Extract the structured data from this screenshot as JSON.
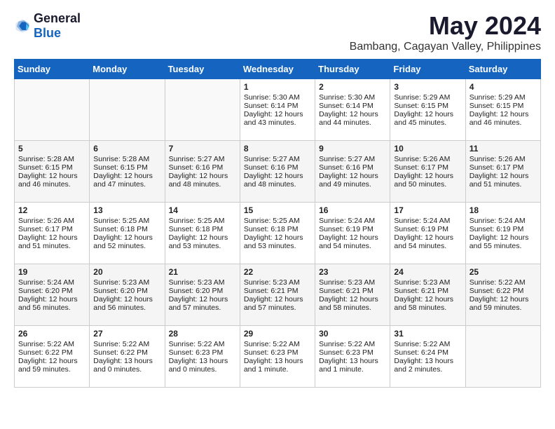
{
  "logo": {
    "general": "General",
    "blue": "Blue"
  },
  "header": {
    "month_year": "May 2024",
    "location": "Bambang, Cagayan Valley, Philippines"
  },
  "days_of_week": [
    "Sunday",
    "Monday",
    "Tuesday",
    "Wednesday",
    "Thursday",
    "Friday",
    "Saturday"
  ],
  "weeks": [
    [
      {
        "day": "",
        "content": ""
      },
      {
        "day": "",
        "content": ""
      },
      {
        "day": "",
        "content": ""
      },
      {
        "day": "1",
        "content": "Sunrise: 5:30 AM\nSunset: 6:14 PM\nDaylight: 12 hours\nand 43 minutes."
      },
      {
        "day": "2",
        "content": "Sunrise: 5:30 AM\nSunset: 6:14 PM\nDaylight: 12 hours\nand 44 minutes."
      },
      {
        "day": "3",
        "content": "Sunrise: 5:29 AM\nSunset: 6:15 PM\nDaylight: 12 hours\nand 45 minutes."
      },
      {
        "day": "4",
        "content": "Sunrise: 5:29 AM\nSunset: 6:15 PM\nDaylight: 12 hours\nand 46 minutes."
      }
    ],
    [
      {
        "day": "5",
        "content": "Sunrise: 5:28 AM\nSunset: 6:15 PM\nDaylight: 12 hours\nand 46 minutes."
      },
      {
        "day": "6",
        "content": "Sunrise: 5:28 AM\nSunset: 6:15 PM\nDaylight: 12 hours\nand 47 minutes."
      },
      {
        "day": "7",
        "content": "Sunrise: 5:27 AM\nSunset: 6:16 PM\nDaylight: 12 hours\nand 48 minutes."
      },
      {
        "day": "8",
        "content": "Sunrise: 5:27 AM\nSunset: 6:16 PM\nDaylight: 12 hours\nand 48 minutes."
      },
      {
        "day": "9",
        "content": "Sunrise: 5:27 AM\nSunset: 6:16 PM\nDaylight: 12 hours\nand 49 minutes."
      },
      {
        "day": "10",
        "content": "Sunrise: 5:26 AM\nSunset: 6:17 PM\nDaylight: 12 hours\nand 50 minutes."
      },
      {
        "day": "11",
        "content": "Sunrise: 5:26 AM\nSunset: 6:17 PM\nDaylight: 12 hours\nand 51 minutes."
      }
    ],
    [
      {
        "day": "12",
        "content": "Sunrise: 5:26 AM\nSunset: 6:17 PM\nDaylight: 12 hours\nand 51 minutes."
      },
      {
        "day": "13",
        "content": "Sunrise: 5:25 AM\nSunset: 6:18 PM\nDaylight: 12 hours\nand 52 minutes."
      },
      {
        "day": "14",
        "content": "Sunrise: 5:25 AM\nSunset: 6:18 PM\nDaylight: 12 hours\nand 53 minutes."
      },
      {
        "day": "15",
        "content": "Sunrise: 5:25 AM\nSunset: 6:18 PM\nDaylight: 12 hours\nand 53 minutes."
      },
      {
        "day": "16",
        "content": "Sunrise: 5:24 AM\nSunset: 6:19 PM\nDaylight: 12 hours\nand 54 minutes."
      },
      {
        "day": "17",
        "content": "Sunrise: 5:24 AM\nSunset: 6:19 PM\nDaylight: 12 hours\nand 54 minutes."
      },
      {
        "day": "18",
        "content": "Sunrise: 5:24 AM\nSunset: 6:19 PM\nDaylight: 12 hours\nand 55 minutes."
      }
    ],
    [
      {
        "day": "19",
        "content": "Sunrise: 5:24 AM\nSunset: 6:20 PM\nDaylight: 12 hours\nand 56 minutes."
      },
      {
        "day": "20",
        "content": "Sunrise: 5:23 AM\nSunset: 6:20 PM\nDaylight: 12 hours\nand 56 minutes."
      },
      {
        "day": "21",
        "content": "Sunrise: 5:23 AM\nSunset: 6:20 PM\nDaylight: 12 hours\nand 57 minutes."
      },
      {
        "day": "22",
        "content": "Sunrise: 5:23 AM\nSunset: 6:21 PM\nDaylight: 12 hours\nand 57 minutes."
      },
      {
        "day": "23",
        "content": "Sunrise: 5:23 AM\nSunset: 6:21 PM\nDaylight: 12 hours\nand 58 minutes."
      },
      {
        "day": "24",
        "content": "Sunrise: 5:23 AM\nSunset: 6:21 PM\nDaylight: 12 hours\nand 58 minutes."
      },
      {
        "day": "25",
        "content": "Sunrise: 5:22 AM\nSunset: 6:22 PM\nDaylight: 12 hours\nand 59 minutes."
      }
    ],
    [
      {
        "day": "26",
        "content": "Sunrise: 5:22 AM\nSunset: 6:22 PM\nDaylight: 12 hours\nand 59 minutes."
      },
      {
        "day": "27",
        "content": "Sunrise: 5:22 AM\nSunset: 6:22 PM\nDaylight: 13 hours\nand 0 minutes."
      },
      {
        "day": "28",
        "content": "Sunrise: 5:22 AM\nSunset: 6:23 PM\nDaylight: 13 hours\nand 0 minutes."
      },
      {
        "day": "29",
        "content": "Sunrise: 5:22 AM\nSunset: 6:23 PM\nDaylight: 13 hours\nand 1 minute."
      },
      {
        "day": "30",
        "content": "Sunrise: 5:22 AM\nSunset: 6:23 PM\nDaylight: 13 hours\nand 1 minute."
      },
      {
        "day": "31",
        "content": "Sunrise: 5:22 AM\nSunset: 6:24 PM\nDaylight: 13 hours\nand 2 minutes."
      },
      {
        "day": "",
        "content": ""
      }
    ]
  ]
}
